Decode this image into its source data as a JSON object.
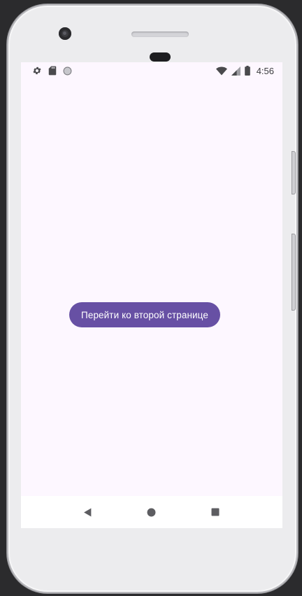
{
  "status_bar": {
    "time": "4:56",
    "left_icons": [
      "gear-icon",
      "sd-card-icon",
      "circle-icon"
    ],
    "right_icons": [
      "wifi-icon",
      "cell-signal-icon",
      "battery-icon"
    ]
  },
  "main": {
    "button_label": "Перейти ко второй странице"
  },
  "navigation": {
    "items": [
      "back-icon",
      "home-icon",
      "recents-icon"
    ]
  },
  "colors": {
    "primary": "#6750a4",
    "screen_background": "#fdf7ff",
    "nav_background": "#ffffff",
    "device_frame": "#ececee",
    "page_background": "#2b2b2d"
  }
}
